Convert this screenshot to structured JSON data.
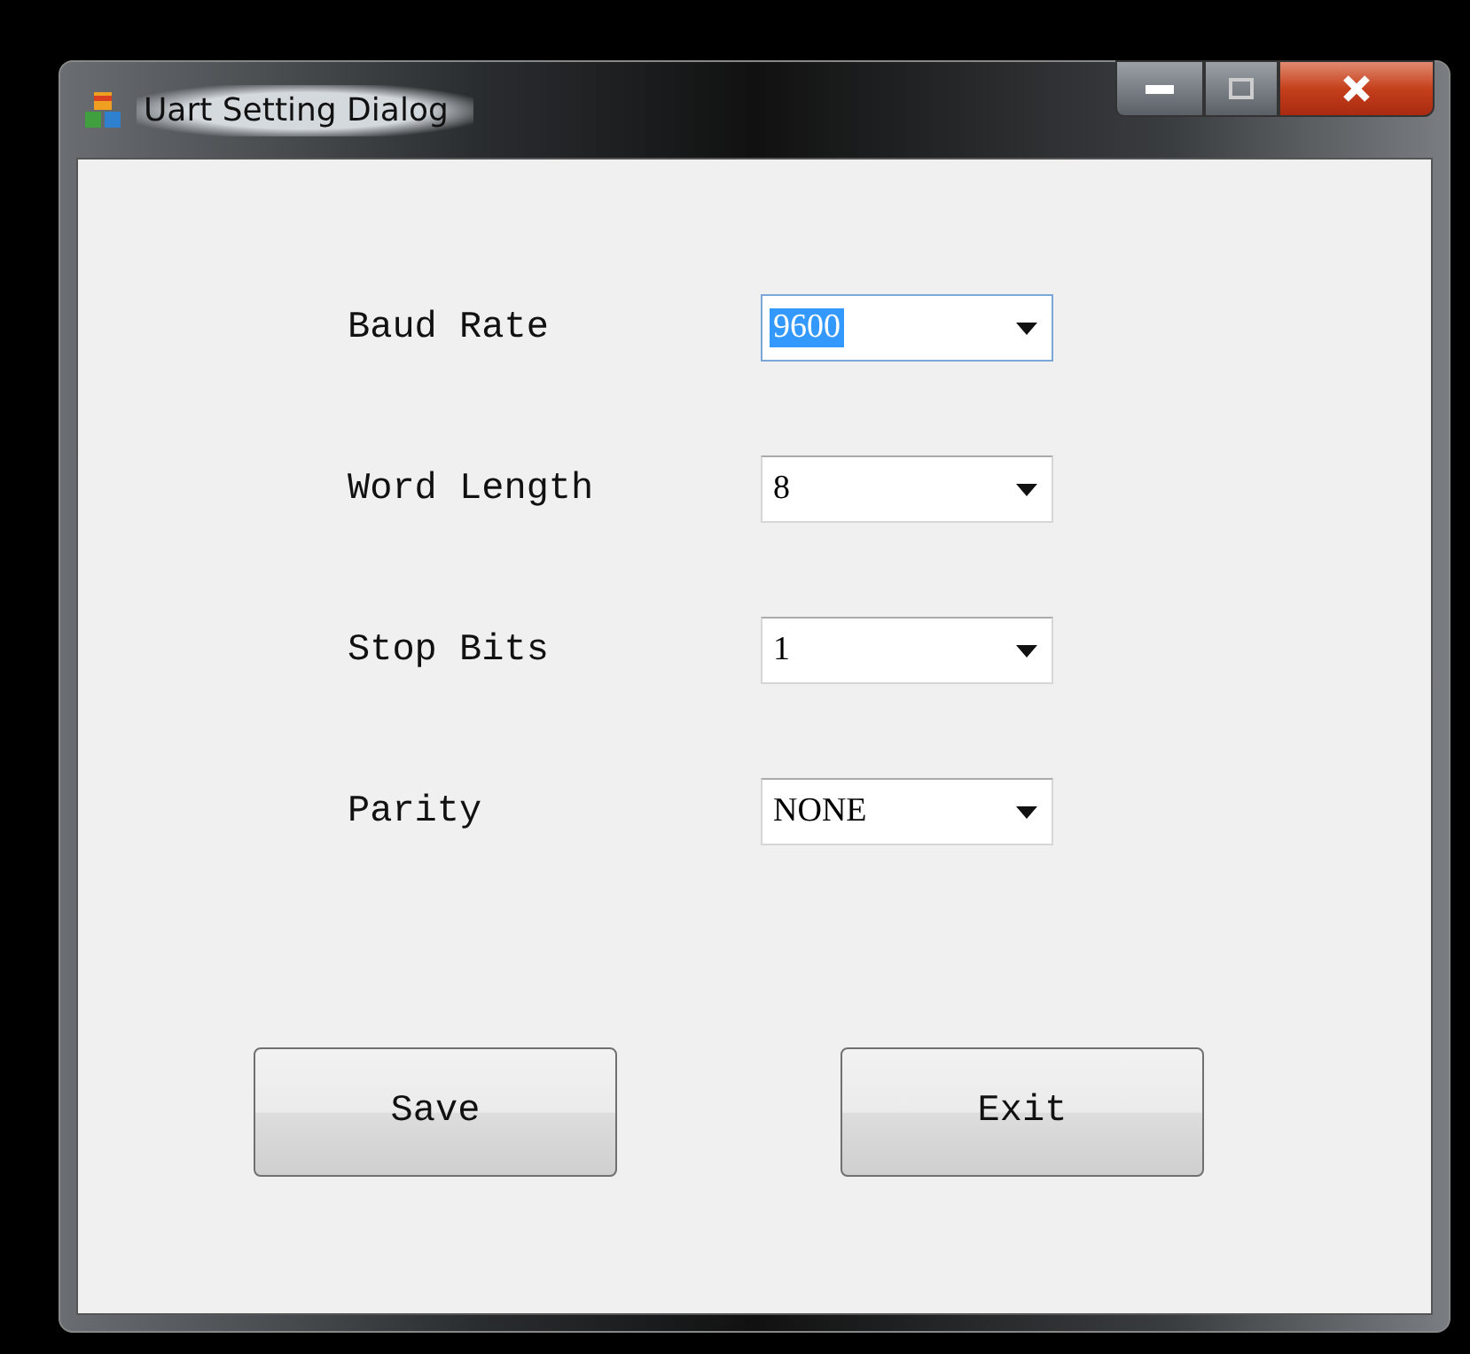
{
  "window": {
    "title": "Uart Setting Dialog"
  },
  "fields": [
    {
      "label": "Baud Rate",
      "value": "9600",
      "focused": true
    },
    {
      "label": "Word Length",
      "value": "8",
      "focused": false
    },
    {
      "label": "Stop Bits",
      "value": "1",
      "focused": false
    },
    {
      "label": "Parity",
      "value": "NONE",
      "focused": false
    }
  ],
  "buttons": [
    "Save",
    "Exit"
  ]
}
